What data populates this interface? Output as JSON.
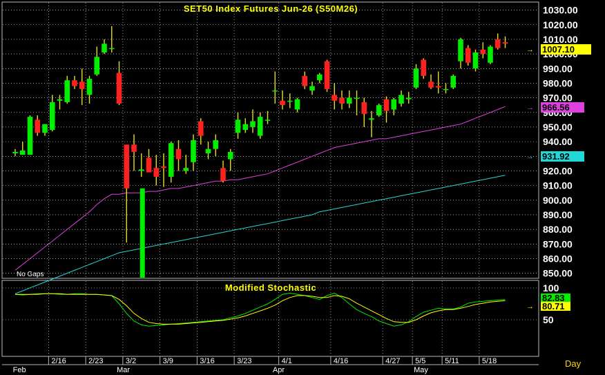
{
  "chart_data": [
    {
      "type": "candlestick",
      "title": "SET50  Index  Futures  Jun-26  (S50M26)",
      "note": "No  Gaps",
      "ylim": [
        847,
        1035
      ],
      "yticks": [
        850,
        860,
        870,
        880,
        890,
        900,
        910,
        920,
        930,
        940,
        950,
        960,
        970,
        980,
        990,
        1000,
        1010,
        1020,
        1030
      ],
      "ytick_labels": [
        "850.00",
        "860.00",
        "870.00",
        "880.00",
        "890.00",
        "900.00",
        "910.00",
        "920.00",
        "930.00",
        "940.00",
        "950.00",
        "960.00",
        "970.00",
        "980.00",
        "990.00",
        "1000.00",
        "1010.00",
        "1020.00",
        "1030.00"
      ],
      "last_price": "1007.10",
      "ma1_label": "966.56",
      "ma2_label": "931.92",
      "colors": {
        "up": "#00ee00",
        "down": "#ff2020",
        "ma1": "#e040e0",
        "ma2": "#20d8d8",
        "title": "#ffff00",
        "grid": "#ffffff"
      },
      "candles": [
        {
          "o": 932,
          "h": 935,
          "l": 930,
          "c": 933
        },
        {
          "o": 931,
          "h": 940,
          "l": 931,
          "c": 934
        },
        {
          "o": 931,
          "h": 958,
          "l": 931,
          "c": 957
        },
        {
          "o": 955,
          "h": 958,
          "l": 944,
          "c": 946
        },
        {
          "o": 946,
          "h": 952,
          "l": 944,
          "c": 952
        },
        {
          "o": 948,
          "h": 972,
          "l": 947,
          "c": 967
        },
        {
          "o": 968,
          "h": 972,
          "l": 962,
          "c": 969
        },
        {
          "o": 967,
          "h": 985,
          "l": 966,
          "c": 982
        },
        {
          "o": 982,
          "h": 985,
          "l": 976,
          "c": 978
        },
        {
          "o": 981,
          "h": 990,
          "l": 965,
          "c": 976
        },
        {
          "o": 972,
          "h": 985,
          "l": 966,
          "c": 983
        },
        {
          "o": 986,
          "h": 1005,
          "l": 985,
          "c": 998
        },
        {
          "o": 1001,
          "h": 1010,
          "l": 1000,
          "c": 1007
        },
        {
          "o": 1004,
          "h": 1019,
          "l": 1001,
          "c": 1004
        },
        {
          "o": 987,
          "h": 995,
          "l": 965,
          "c": 966
        },
        {
          "o": 938,
          "h": 938,
          "l": 871,
          "c": 908
        },
        {
          "o": 938,
          "h": 945,
          "l": 920,
          "c": 933
        },
        {
          "o": 920,
          "h": 932,
          "l": 916,
          "c": 921
        },
        {
          "o": 929,
          "h": 935,
          "l": 919,
          "c": 919
        },
        {
          "o": 922,
          "h": 931,
          "l": 910,
          "c": 916
        },
        {
          "o": 923,
          "h": 932,
          "l": 909,
          "c": 922
        },
        {
          "o": 916,
          "h": 940,
          "l": 912,
          "c": 939
        },
        {
          "o": 935,
          "h": 941,
          "l": 920,
          "c": 928
        },
        {
          "o": 920,
          "h": 931,
          "l": 918,
          "c": 922
        },
        {
          "o": 926,
          "h": 945,
          "l": 920,
          "c": 941
        },
        {
          "o": 954,
          "h": 956,
          "l": 938,
          "c": 944
        },
        {
          "o": 932,
          "h": 940,
          "l": 928,
          "c": 935
        },
        {
          "o": 935,
          "h": 945,
          "l": 930,
          "c": 941
        },
        {
          "o": 922,
          "h": 927,
          "l": 912,
          "c": 913
        },
        {
          "o": 928,
          "h": 935,
          "l": 920,
          "c": 933
        },
        {
          "o": 946,
          "h": 960,
          "l": 942,
          "c": 955
        },
        {
          "o": 948,
          "h": 956,
          "l": 946,
          "c": 952
        },
        {
          "o": 950,
          "h": 962,
          "l": 946,
          "c": 954
        },
        {
          "o": 944,
          "h": 960,
          "l": 942,
          "c": 957
        },
        {
          "o": 955,
          "h": 961,
          "l": 952,
          "c": 955
        },
        {
          "o": 975,
          "h": 988,
          "l": 966,
          "c": 975
        },
        {
          "o": 968,
          "h": 975,
          "l": 962,
          "c": 965
        },
        {
          "o": 968,
          "h": 973,
          "l": 963,
          "c": 968
        },
        {
          "o": 962,
          "h": 970,
          "l": 960,
          "c": 969
        },
        {
          "o": 985,
          "h": 988,
          "l": 976,
          "c": 978
        },
        {
          "o": 975,
          "h": 981,
          "l": 972,
          "c": 978
        },
        {
          "o": 982,
          "h": 987,
          "l": 980,
          "c": 986
        },
        {
          "o": 995,
          "h": 996,
          "l": 974,
          "c": 976
        },
        {
          "o": 972,
          "h": 980,
          "l": 962,
          "c": 968
        },
        {
          "o": 970,
          "h": 975,
          "l": 962,
          "c": 966
        },
        {
          "o": 966,
          "h": 975,
          "l": 963,
          "c": 970
        },
        {
          "o": 970,
          "h": 975,
          "l": 958,
          "c": 970
        },
        {
          "o": 967,
          "h": 970,
          "l": 950,
          "c": 959
        },
        {
          "o": 955,
          "h": 961,
          "l": 943,
          "c": 956
        },
        {
          "o": 958,
          "h": 966,
          "l": 957,
          "c": 965
        },
        {
          "o": 969,
          "h": 971,
          "l": 953,
          "c": 961
        },
        {
          "o": 962,
          "h": 970,
          "l": 958,
          "c": 969
        },
        {
          "o": 966,
          "h": 975,
          "l": 964,
          "c": 972
        },
        {
          "o": 969,
          "h": 974,
          "l": 966,
          "c": 970
        },
        {
          "o": 977,
          "h": 993,
          "l": 976,
          "c": 990
        },
        {
          "o": 996,
          "h": 997,
          "l": 983,
          "c": 985
        },
        {
          "o": 981,
          "h": 986,
          "l": 976,
          "c": 977
        },
        {
          "o": 978,
          "h": 988,
          "l": 973,
          "c": 977
        },
        {
          "o": 976,
          "h": 980,
          "l": 973,
          "c": 976
        },
        {
          "o": 977,
          "h": 986,
          "l": 976,
          "c": 985
        },
        {
          "o": 995,
          "h": 1011,
          "l": 990,
          "c": 1010
        },
        {
          "o": 1004,
          "h": 1006,
          "l": 992,
          "c": 994
        },
        {
          "o": 990,
          "h": 1003,
          "l": 988,
          "c": 1001
        },
        {
          "o": 1003,
          "h": 1008,
          "l": 997,
          "c": 1000
        },
        {
          "o": 994,
          "h": 1006,
          "l": 993,
          "c": 1005
        },
        {
          "o": 1010,
          "h": 1014,
          "l": 1003,
          "c": 1004
        },
        {
          "o": 1008,
          "h": 1012,
          "l": 1004,
          "c": 1007.1
        }
      ],
      "ma1": [
        852,
        856,
        860,
        864,
        868,
        872,
        876,
        880,
        884,
        888,
        892,
        897,
        901,
        904,
        904,
        905,
        905,
        905,
        906,
        906,
        907,
        908,
        908,
        909,
        910,
        911,
        912,
        913,
        913,
        914,
        914,
        915,
        916,
        917,
        918,
        920,
        922,
        924,
        926,
        928,
        930,
        932,
        934,
        936,
        937,
        938,
        939,
        940,
        941,
        942,
        942,
        943,
        944,
        945,
        946,
        947,
        948,
        949,
        950,
        951,
        952,
        954,
        956,
        958,
        960,
        962,
        964,
        966.56
      ],
      "ma2": [
        836,
        838,
        840,
        842,
        844,
        846,
        848,
        850,
        852,
        854,
        856,
        858,
        860,
        862,
        864,
        865,
        866,
        867,
        868,
        869,
        870,
        871,
        872,
        873,
        874,
        875,
        876,
        877,
        878,
        879,
        880,
        881,
        882,
        883,
        884,
        885,
        886,
        887,
        888,
        889,
        890,
        892,
        893,
        894,
        895,
        896,
        897,
        898,
        899,
        900,
        901,
        902,
        903,
        904,
        905,
        906,
        907,
        908,
        909,
        910,
        911,
        912,
        913,
        914,
        915,
        916,
        917,
        931.92
      ]
    },
    {
      "type": "line",
      "title": "Modified  Stochastic",
      "ylim": [
        0,
        100
      ],
      "yticks": [
        50,
        100
      ],
      "ytick_labels": [
        "50",
        "100"
      ],
      "k_label": "82.83",
      "d_label": "80.71",
      "series": [
        {
          "values": [
            90,
            89,
            90,
            91,
            91,
            91,
            90,
            90,
            91,
            91,
            90,
            90,
            89,
            88,
            75,
            60,
            48,
            42,
            40,
            41,
            42,
            43,
            44,
            45,
            46,
            47,
            48,
            49,
            50,
            53,
            56,
            60,
            65,
            70,
            75,
            82,
            90,
            92,
            90,
            88,
            85,
            82,
            88,
            92,
            85,
            75,
            66,
            60,
            55,
            48,
            44,
            40,
            42,
            47,
            55,
            62,
            65,
            68,
            67,
            67,
            70,
            76,
            78,
            79,
            80,
            81,
            82,
            82.83
          ]
        },
        {
          "values": [
            90,
            90,
            90,
            90,
            91,
            91,
            91,
            90,
            90,
            90,
            90,
            90,
            89,
            88,
            82,
            72,
            60,
            52,
            46,
            44,
            43,
            43,
            43,
            44,
            45,
            46,
            47,
            48,
            49,
            51,
            53,
            56,
            60,
            64,
            68,
            73,
            80,
            85,
            88,
            88,
            87,
            85,
            85,
            88,
            87,
            83,
            76,
            70,
            64,
            58,
            52,
            47,
            46,
            46,
            50,
            56,
            61,
            64,
            66,
            66,
            68,
            71,
            74,
            76,
            78,
            79,
            80,
            80.71
          ]
        }
      ]
    }
  ],
  "x_ticks": [
    "2/16",
    "2/23",
    "3/2",
    "3/9",
    "3/16",
    "3/23",
    "4/1",
    "4/16",
    "4/27",
    "5/5",
    "5/11",
    "5/18"
  ],
  "month_labels": [
    "Feb",
    "Mar",
    "Apr",
    "May"
  ],
  "x_unit": "Day"
}
